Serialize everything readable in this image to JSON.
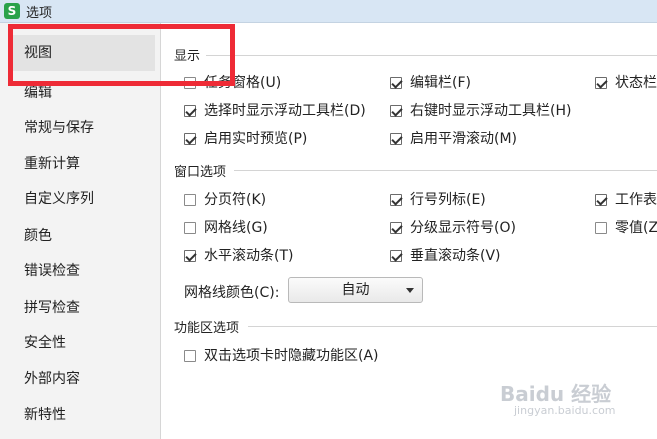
{
  "window": {
    "title": "选项",
    "app_icon": "S"
  },
  "sidebar": {
    "items": [
      {
        "label": "视图",
        "active": true
      },
      {
        "label": "编辑"
      },
      {
        "label": "常规与保存"
      },
      {
        "label": "重新计算"
      },
      {
        "label": "自定义序列"
      },
      {
        "label": "颜色"
      },
      {
        "label": "错误检查"
      },
      {
        "label": "拼写检查"
      },
      {
        "label": "安全性"
      },
      {
        "label": "外部内容"
      },
      {
        "label": "新特性"
      }
    ]
  },
  "display": {
    "title": "显示",
    "options": [
      {
        "label": "任务窗格(U)",
        "checked": false
      },
      {
        "label": "编辑栏(F)",
        "checked": true
      },
      {
        "label": "状态栏",
        "checked": true
      },
      {
        "label": "选择时显示浮动工具栏(D)",
        "checked": true
      },
      {
        "label": "右键时显示浮动工具栏(H)",
        "checked": true
      },
      {
        "label": "启用实时预览(P)",
        "checked": true
      },
      {
        "label": "启用平滑滚动(M)",
        "checked": true
      }
    ]
  },
  "window_options": {
    "title": "窗口选项",
    "options": [
      {
        "label": "分页符(K)",
        "checked": false
      },
      {
        "label": "行号列标(E)",
        "checked": true
      },
      {
        "label": "工作表",
        "checked": true
      },
      {
        "label": "网格线(G)",
        "checked": false
      },
      {
        "label": "分级显示符号(O)",
        "checked": true
      },
      {
        "label": "零值(Z",
        "checked": false
      },
      {
        "label": "水平滚动条(T)",
        "checked": true
      },
      {
        "label": "垂直滚动条(V)",
        "checked": true
      }
    ],
    "gridline_color_label": "网格线颜色(C):",
    "gridline_color_value": "自动"
  },
  "ribbon": {
    "title": "功能区选项",
    "options": [
      {
        "label": "双击选项卡时隐藏功能区(A)",
        "checked": false
      }
    ]
  },
  "colors": {
    "highlight": "#ee2b36",
    "titlebar": "#d8e6f4"
  },
  "watermark": {
    "text": "Baidu 经验",
    "sub": "jingyan.baidu.com"
  }
}
